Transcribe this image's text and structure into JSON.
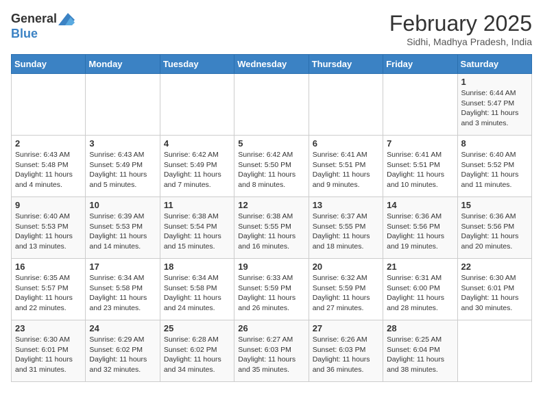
{
  "logo": {
    "general": "General",
    "blue": "Blue"
  },
  "title": "February 2025",
  "subtitle": "Sidhi, Madhya Pradesh, India",
  "days_of_week": [
    "Sunday",
    "Monday",
    "Tuesday",
    "Wednesday",
    "Thursday",
    "Friday",
    "Saturday"
  ],
  "weeks": [
    [
      {
        "day": "",
        "info": ""
      },
      {
        "day": "",
        "info": ""
      },
      {
        "day": "",
        "info": ""
      },
      {
        "day": "",
        "info": ""
      },
      {
        "day": "",
        "info": ""
      },
      {
        "day": "",
        "info": ""
      },
      {
        "day": "1",
        "info": "Sunrise: 6:44 AM\nSunset: 5:47 PM\nDaylight: 11 hours\nand 3 minutes."
      }
    ],
    [
      {
        "day": "2",
        "info": "Sunrise: 6:43 AM\nSunset: 5:48 PM\nDaylight: 11 hours\nand 4 minutes."
      },
      {
        "day": "3",
        "info": "Sunrise: 6:43 AM\nSunset: 5:49 PM\nDaylight: 11 hours\nand 5 minutes."
      },
      {
        "day": "4",
        "info": "Sunrise: 6:42 AM\nSunset: 5:49 PM\nDaylight: 11 hours\nand 7 minutes."
      },
      {
        "day": "5",
        "info": "Sunrise: 6:42 AM\nSunset: 5:50 PM\nDaylight: 11 hours\nand 8 minutes."
      },
      {
        "day": "6",
        "info": "Sunrise: 6:41 AM\nSunset: 5:51 PM\nDaylight: 11 hours\nand 9 minutes."
      },
      {
        "day": "7",
        "info": "Sunrise: 6:41 AM\nSunset: 5:51 PM\nDaylight: 11 hours\nand 10 minutes."
      },
      {
        "day": "8",
        "info": "Sunrise: 6:40 AM\nSunset: 5:52 PM\nDaylight: 11 hours\nand 11 minutes."
      }
    ],
    [
      {
        "day": "9",
        "info": "Sunrise: 6:40 AM\nSunset: 5:53 PM\nDaylight: 11 hours\nand 13 minutes."
      },
      {
        "day": "10",
        "info": "Sunrise: 6:39 AM\nSunset: 5:53 PM\nDaylight: 11 hours\nand 14 minutes."
      },
      {
        "day": "11",
        "info": "Sunrise: 6:38 AM\nSunset: 5:54 PM\nDaylight: 11 hours\nand 15 minutes."
      },
      {
        "day": "12",
        "info": "Sunrise: 6:38 AM\nSunset: 5:55 PM\nDaylight: 11 hours\nand 16 minutes."
      },
      {
        "day": "13",
        "info": "Sunrise: 6:37 AM\nSunset: 5:55 PM\nDaylight: 11 hours\nand 18 minutes."
      },
      {
        "day": "14",
        "info": "Sunrise: 6:36 AM\nSunset: 5:56 PM\nDaylight: 11 hours\nand 19 minutes."
      },
      {
        "day": "15",
        "info": "Sunrise: 6:36 AM\nSunset: 5:56 PM\nDaylight: 11 hours\nand 20 minutes."
      }
    ],
    [
      {
        "day": "16",
        "info": "Sunrise: 6:35 AM\nSunset: 5:57 PM\nDaylight: 11 hours\nand 22 minutes."
      },
      {
        "day": "17",
        "info": "Sunrise: 6:34 AM\nSunset: 5:58 PM\nDaylight: 11 hours\nand 23 minutes."
      },
      {
        "day": "18",
        "info": "Sunrise: 6:34 AM\nSunset: 5:58 PM\nDaylight: 11 hours\nand 24 minutes."
      },
      {
        "day": "19",
        "info": "Sunrise: 6:33 AM\nSunset: 5:59 PM\nDaylight: 11 hours\nand 26 minutes."
      },
      {
        "day": "20",
        "info": "Sunrise: 6:32 AM\nSunset: 5:59 PM\nDaylight: 11 hours\nand 27 minutes."
      },
      {
        "day": "21",
        "info": "Sunrise: 6:31 AM\nSunset: 6:00 PM\nDaylight: 11 hours\nand 28 minutes."
      },
      {
        "day": "22",
        "info": "Sunrise: 6:30 AM\nSunset: 6:01 PM\nDaylight: 11 hours\nand 30 minutes."
      }
    ],
    [
      {
        "day": "23",
        "info": "Sunrise: 6:30 AM\nSunset: 6:01 PM\nDaylight: 11 hours\nand 31 minutes."
      },
      {
        "day": "24",
        "info": "Sunrise: 6:29 AM\nSunset: 6:02 PM\nDaylight: 11 hours\nand 32 minutes."
      },
      {
        "day": "25",
        "info": "Sunrise: 6:28 AM\nSunset: 6:02 PM\nDaylight: 11 hours\nand 34 minutes."
      },
      {
        "day": "26",
        "info": "Sunrise: 6:27 AM\nSunset: 6:03 PM\nDaylight: 11 hours\nand 35 minutes."
      },
      {
        "day": "27",
        "info": "Sunrise: 6:26 AM\nSunset: 6:03 PM\nDaylight: 11 hours\nand 36 minutes."
      },
      {
        "day": "28",
        "info": "Sunrise: 6:25 AM\nSunset: 6:04 PM\nDaylight: 11 hours\nand 38 minutes."
      },
      {
        "day": "",
        "info": ""
      }
    ]
  ]
}
